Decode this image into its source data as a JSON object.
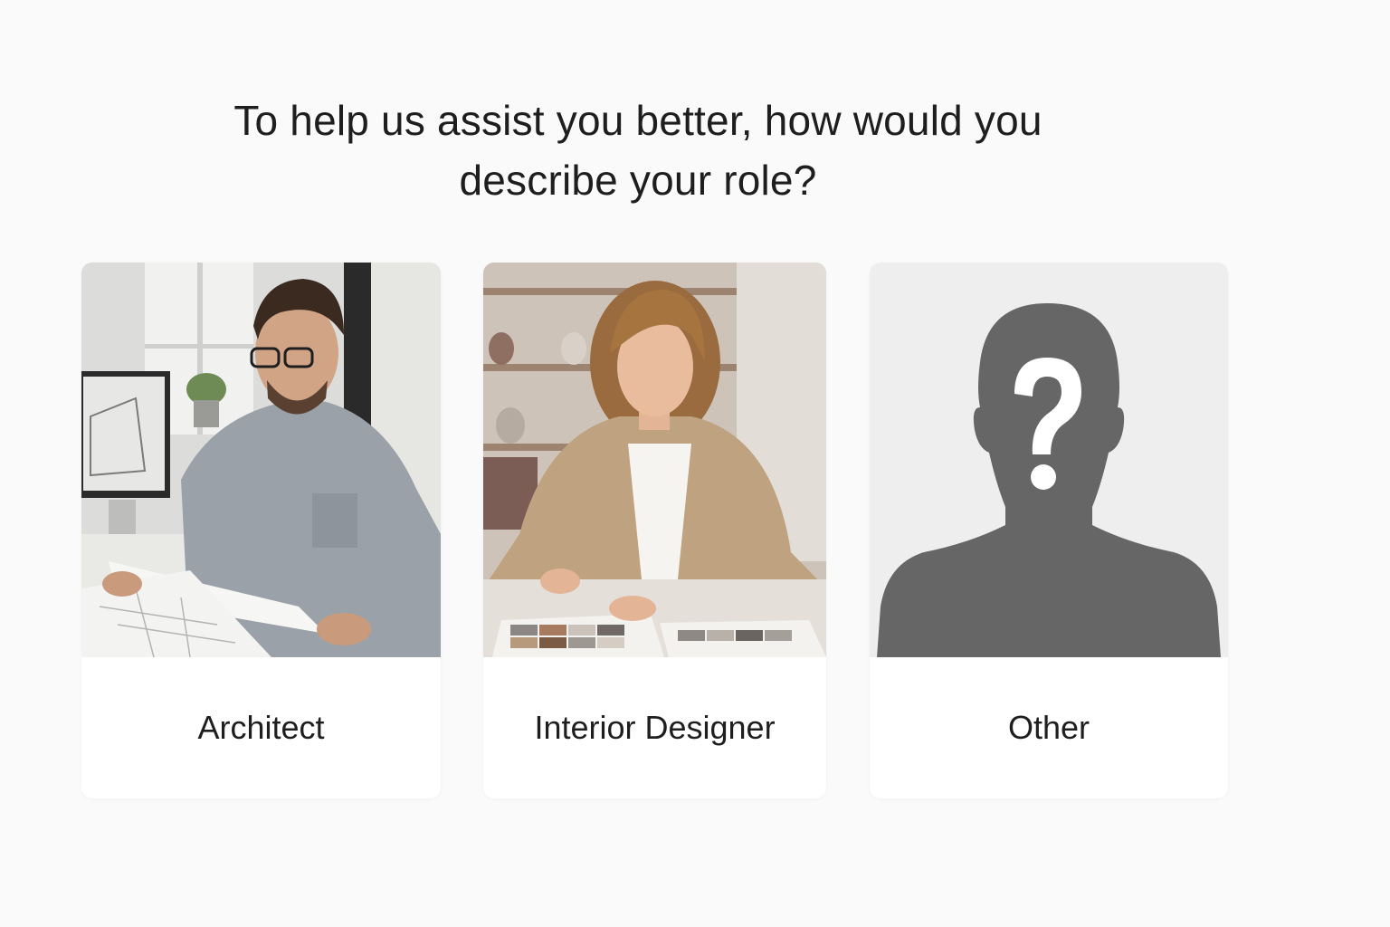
{
  "question": {
    "line1": "To help us assist you better, how would you",
    "line2": "describe your role?"
  },
  "roles": [
    {
      "label": "Architect",
      "image": "architect-photo"
    },
    {
      "label": "Interior Designer",
      "image": "interior-designer-photo"
    },
    {
      "label": "Other",
      "image": "unknown-person-silhouette-icon"
    }
  ],
  "colors": {
    "background": "#fafafa",
    "card": "#ffffff",
    "text": "#1e1e1e",
    "silhouette": "#666666"
  }
}
